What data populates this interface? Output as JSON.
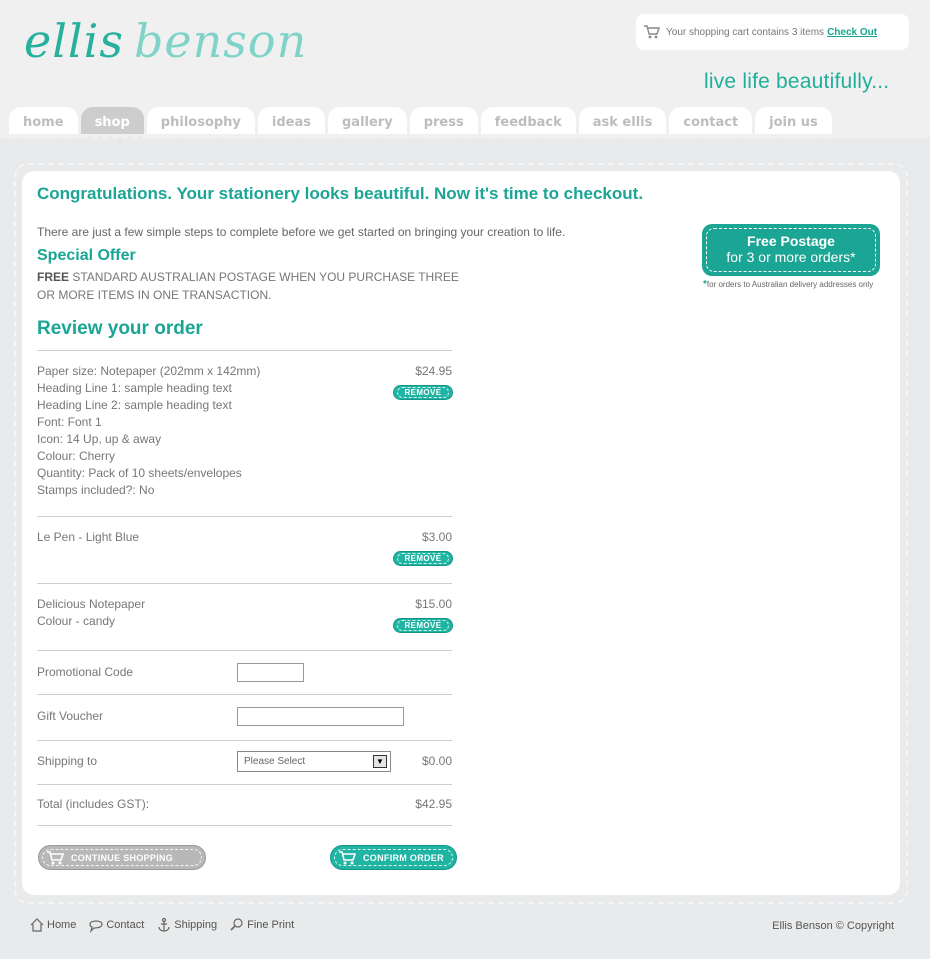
{
  "brand": {
    "logo_part1": "ellis",
    "logo_part2": "benson",
    "tagline": "live life beautifully..."
  },
  "cart": {
    "icon": "cart-icon",
    "text": "Your shopping cart contains 3 items",
    "checkout_label": "Check Out"
  },
  "nav": {
    "tabs": [
      {
        "label": "home",
        "active": false
      },
      {
        "label": "shop",
        "active": true
      },
      {
        "label": "philosophy",
        "active": false
      },
      {
        "label": "ideas",
        "active": false
      },
      {
        "label": "gallery",
        "active": false
      },
      {
        "label": "press",
        "active": false
      },
      {
        "label": "feedback",
        "active": false
      },
      {
        "label": "ask ellis",
        "active": false
      },
      {
        "label": "contact",
        "active": false
      },
      {
        "label": "join us",
        "active": false
      }
    ]
  },
  "main": {
    "headline": "Congratulations. Your stationery looks beautiful. Now it's time to checkout.",
    "intro": "There are just a few simple steps to complete before we get started on bringing your creation to life.",
    "special_title": "Special Offer",
    "special_bold": "FREE",
    "special_text": "STANDARD AUSTRALIAN POSTAGE WHEN YOU PURCHASE THREE OR MORE ITEMS IN ONE TRANSACTION.",
    "review_title": "Review your order"
  },
  "postage_badge": {
    "line1": "Free Postage",
    "line2": "for 3 or more orders*",
    "note_star": "*",
    "note": "for orders to Australian delivery addresses only"
  },
  "order": {
    "remove_label": "REMOVE",
    "items": [
      {
        "lines": [
          "Paper size: Notepaper (202mm x 142mm)",
          "Heading Line 1: sample heading text",
          "Heading Line 2: sample heading text",
          "Font: Font 1",
          "Icon: 14 Up, up & away",
          "Colour: Cherry",
          "Quantity: Pack of 10 sheets/envelopes",
          "Stamps included?: No"
        ],
        "price": "$24.95"
      },
      {
        "lines": [
          "Le Pen - Light Blue"
        ],
        "price": "$3.00"
      },
      {
        "lines": [
          "Delicious Notepaper",
          "Colour - candy"
        ],
        "price": "$15.00"
      }
    ],
    "promo_label": "Promotional Code",
    "promo_value": "",
    "voucher_label": "Gift Voucher",
    "voucher_value": "",
    "shipping_label": "Shipping to",
    "shipping_selected": "Please Select",
    "shipping_price": "$0.00",
    "total_label": "Total (includes GST):",
    "total_value": "$42.95",
    "continue_label": "CONTINUE SHOPPING",
    "confirm_label": "CONFIRM ORDER"
  },
  "footer": {
    "links": [
      {
        "label": "Home",
        "icon": "home-icon"
      },
      {
        "label": "Contact",
        "icon": "speech-bubble-icon"
      },
      {
        "label": "Shipping",
        "icon": "anchor-icon"
      },
      {
        "label": "Fine Print",
        "icon": "magnifier-icon"
      }
    ],
    "copyright": "Ellis Benson © Copyright"
  },
  "colors": {
    "accent": "#1aa594",
    "button_teal": "#1fb5a2",
    "button_grey": "#b8b8b8",
    "background": "#e9eaeb"
  }
}
